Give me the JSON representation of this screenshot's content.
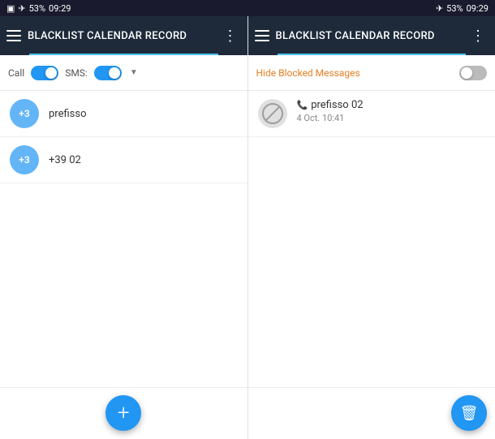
{
  "statusBar": {
    "leftIcon": "screen-icon",
    "signal": "✈",
    "battery": "53%",
    "time": "09:29"
  },
  "leftPanel": {
    "appBar": {
      "menuIcon": "hamburger-icon",
      "title": "BLACKLIST CALENDAR RECORD",
      "moreIcon": "more-dots-icon"
    },
    "filterBar": {
      "callLabel": "Call",
      "smsLabel": "SMS:"
    },
    "listItems": [
      {
        "avatar": "+3",
        "text": "prefisso"
      },
      {
        "avatar": "+3",
        "text": "+39 02"
      }
    ],
    "fab": {
      "label": "+"
    }
  },
  "rightPanel": {
    "appBar": {
      "menuIcon": "hamburger-icon",
      "title": "BLACKLIST CALENDAR RECORD",
      "moreIcon": "more-dots-icon"
    },
    "filterBar": {
      "hideBlockedLabel": "Hide Blocked Messages"
    },
    "listItems": [
      {
        "number": "prefisso 02",
        "date": "4 Oct. 10:41"
      }
    ],
    "fab": {
      "label": "🗑"
    }
  }
}
